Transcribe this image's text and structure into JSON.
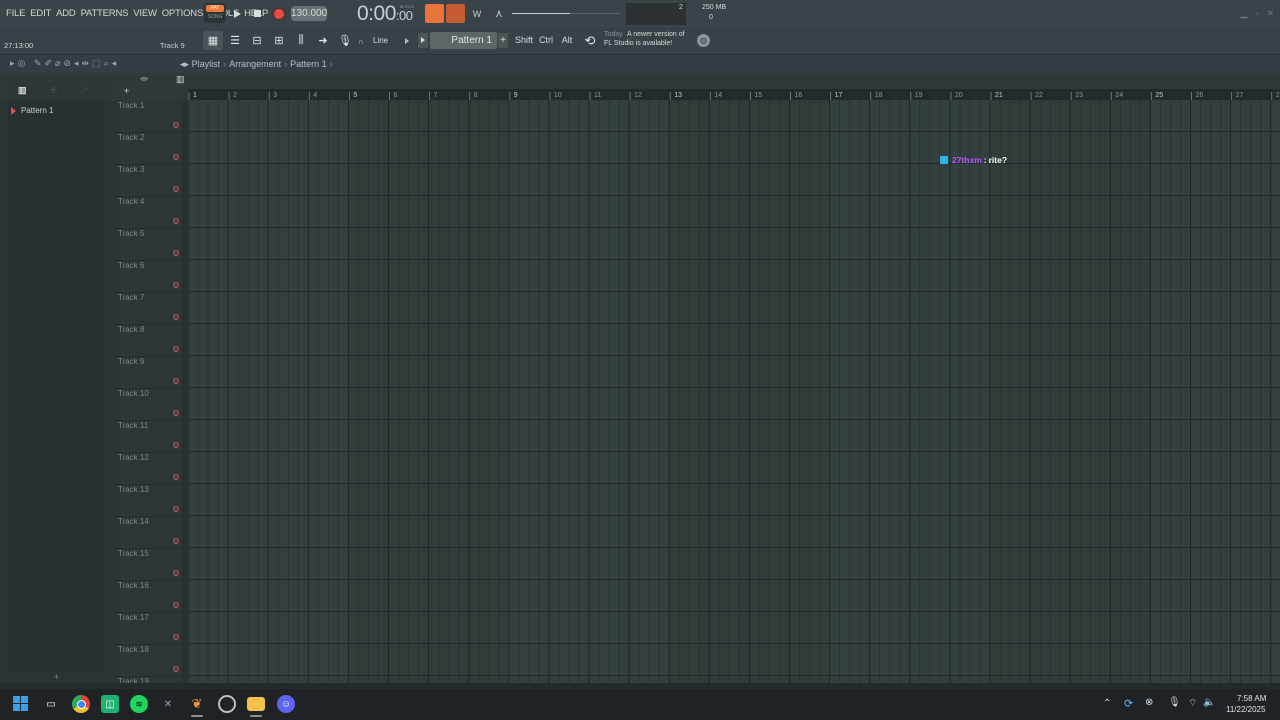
{
  "menu": [
    "FILE",
    "EDIT",
    "ADD",
    "PATTERNS",
    "VIEW",
    "OPTIONS",
    "TOOLS",
    "HELP"
  ],
  "transport": {
    "pat_label": "PAT",
    "song_label": "SONG",
    "tempo": "130.000",
    "time_main": "0:00",
    "time_small": ":00",
    "time_unit": "M:S:CS"
  },
  "monitor": {
    "cpu": "2",
    "memory": "250 MB",
    "polyphony": "0"
  },
  "toolbar2": {
    "hint_text": "",
    "song_position": "27:13:00",
    "selected_track": "Track 9",
    "snap_value": "Line",
    "pattern_selector": "Pattern 1",
    "pattern_add": "+",
    "shift_label": "Shift",
    "ctrl_label": "Ctrl",
    "alt_label": "Alt",
    "news_date": "Today",
    "news_line1": "A newer version of",
    "news_line2": "FL Studio is available!"
  },
  "playlist": {
    "path": [
      "Playlist",
      "Arrangement",
      "Pattern 1"
    ],
    "patterns": [
      "Pattern 1"
    ],
    "footer_add": "+",
    "header_plus": "+",
    "tracks": [
      "Track 1",
      "Track 2",
      "Track 3",
      "Track 4",
      "Track 5",
      "Track 6",
      "Track 7",
      "Track 8",
      "Track 9",
      "Track 10",
      "Track 11",
      "Track 12",
      "Track 13",
      "Track 14",
      "Track 15",
      "Track 16",
      "Track 17",
      "Track 18",
      "Track 19"
    ],
    "bars": [
      "1",
      "2",
      "3",
      "4",
      "5",
      "6",
      "7",
      "8",
      "9",
      "10",
      "11",
      "12",
      "13",
      "14",
      "15",
      "16",
      "17",
      "18",
      "19",
      "20",
      "21",
      "22",
      "23",
      "24",
      "25",
      "26",
      "27",
      "28"
    ]
  },
  "chat_overlay": {
    "user": "27thxm",
    "separator": ":",
    "text": "rite?"
  },
  "taskbar": {
    "clock_time": "7:58 AM",
    "clock_date": "11/22/2025"
  },
  "colors": {
    "accent": "#f0793c",
    "record": "#e84e3f",
    "chat_user": "#b255ff",
    "track_marker": "#d14f54"
  }
}
